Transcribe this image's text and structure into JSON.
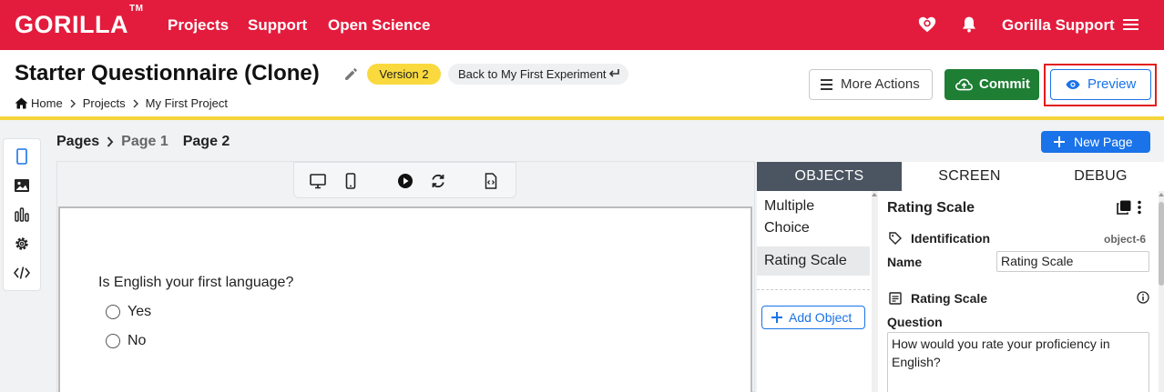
{
  "nav": {
    "logo": "GORILLA",
    "logo_tm": "TM",
    "links": [
      "Projects",
      "Support",
      "Open Science"
    ],
    "user": "Gorilla Support",
    "color": "#e31c3d"
  },
  "header": {
    "title": "Starter Questionnaire (Clone)",
    "version": "Version 2",
    "back_label": "Back to My First Experiment",
    "breadcrumbs": [
      "Home",
      "Projects",
      "My First Project"
    ],
    "more_actions": "More Actions",
    "commit": "Commit",
    "preview": "Preview"
  },
  "pages": {
    "label": "Pages",
    "items": [
      "Page 1",
      "Page 2"
    ],
    "new_page": "New Page"
  },
  "canvas": {
    "question": "Is English your first language?",
    "options": [
      "Yes",
      "No"
    ]
  },
  "panel": {
    "tabs": [
      "OBJECTS",
      "SCREEN",
      "DEBUG"
    ],
    "objects": [
      "Multiple Choice",
      "Rating Scale"
    ],
    "add_object": "Add Object",
    "selected_title": "Rating Scale",
    "identification": "Identification",
    "object_id": "object-6",
    "name_label": "Name",
    "name_value": "Rating Scale",
    "section_title": "Rating Scale",
    "question_label": "Question",
    "question_value": "How would you rate your proficiency in English?"
  },
  "colors": {
    "accent": "#1a73e8",
    "commit": "#1e7e34",
    "version_badge": "#f9d93e",
    "active_tab": "#4b5461"
  }
}
